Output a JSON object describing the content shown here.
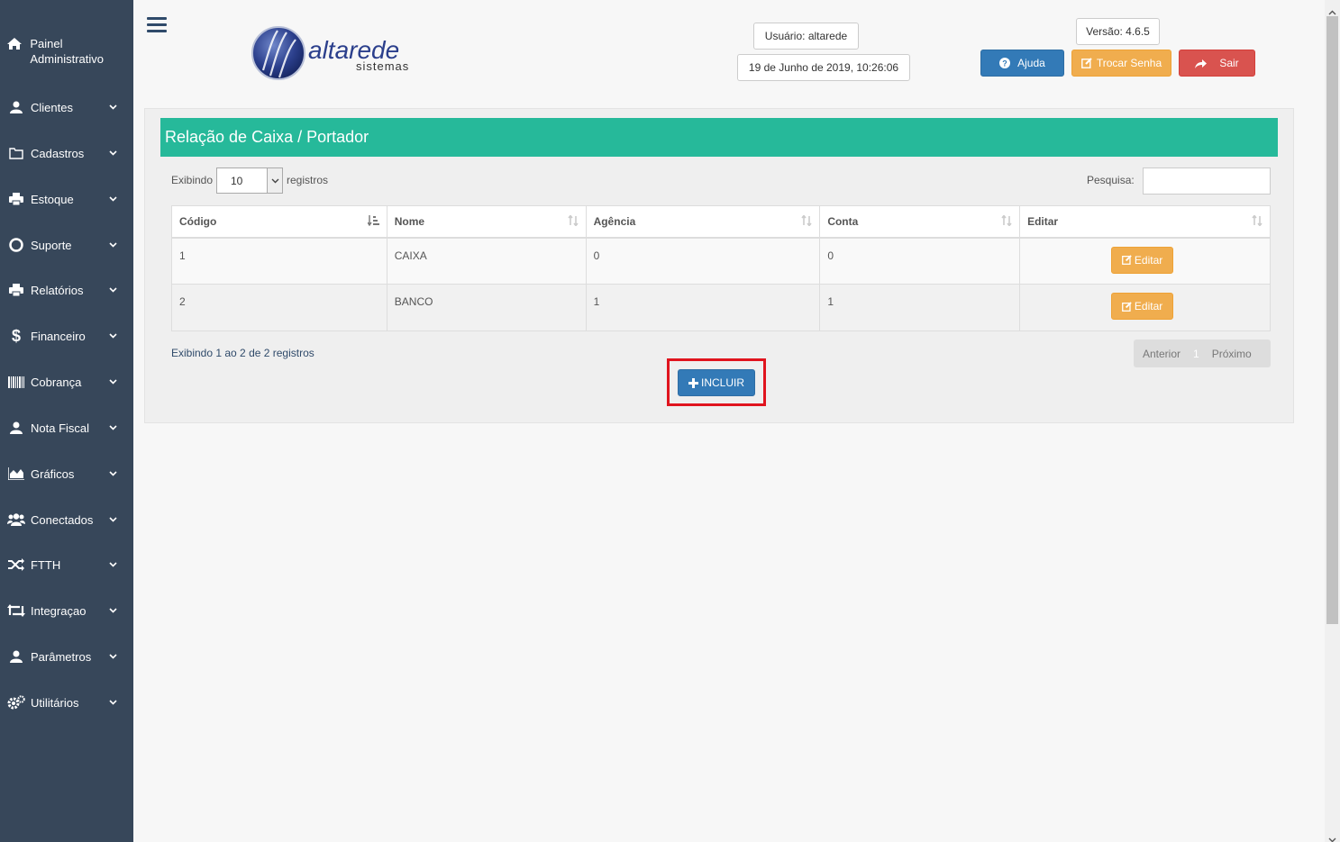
{
  "sidebar": {
    "header": "Painel Administrativo",
    "items": [
      {
        "label": "Clientes",
        "icon": "user-icon"
      },
      {
        "label": "Cadastros",
        "icon": "folder-icon"
      },
      {
        "label": "Estoque",
        "icon": "print-icon"
      },
      {
        "label": "Suporte",
        "icon": "life-ring-icon"
      },
      {
        "label": "Relatórios",
        "icon": "print-icon"
      },
      {
        "label": "Financeiro",
        "icon": "dollar-icon"
      },
      {
        "label": "Cobrança",
        "icon": "barcode-icon"
      },
      {
        "label": "Nota Fiscal",
        "icon": "user-icon"
      },
      {
        "label": "Gráficos",
        "icon": "area-chart-icon"
      },
      {
        "label": "Conectados",
        "icon": "users-icon"
      },
      {
        "label": "FTTH",
        "icon": "random-icon"
      },
      {
        "label": "Integraçao",
        "icon": "retweet-icon"
      },
      {
        "label": "Parâmetros",
        "icon": "user-icon"
      },
      {
        "label": "Utilitários",
        "icon": "cogs-icon"
      }
    ]
  },
  "header": {
    "logo_word": "altarede",
    "logo_sub": "sistemas",
    "user": "Usuário: altarede",
    "datetime": "19 de Junho de 2019, 10:26:06",
    "version": "Versão: 4.6.5",
    "help_label": "Ajuda",
    "change_password_label": "Trocar Senha",
    "logout_label": "Sair"
  },
  "panel": {
    "title": "Relação de Caixa / Portador",
    "show_label": "Exibindo",
    "page_length": "10",
    "records_label": "registros",
    "search_label": "Pesquisa:",
    "columns": [
      "Código",
      "Nome",
      "Agência",
      "Conta",
      "Editar"
    ],
    "rows": [
      {
        "codigo": "1",
        "nome": "CAIXA",
        "agencia": "0",
        "conta": "0",
        "action": "Editar"
      },
      {
        "codigo": "2",
        "nome": "BANCO",
        "agencia": "1",
        "conta": "1",
        "action": "Editar"
      }
    ],
    "info": "Exibindo 1 ao 2 de 2 registros",
    "pager": {
      "prev": "Anterior",
      "current": "1",
      "next": "Próximo"
    },
    "add_label": "INCLUIR"
  },
  "colors": {
    "sidebar_bg": "#37475a",
    "title_bar": "#26b99a",
    "primary": "#337ab7",
    "warning": "#f0ad4e",
    "danger": "#d9534f",
    "highlight": "#e0141e"
  }
}
